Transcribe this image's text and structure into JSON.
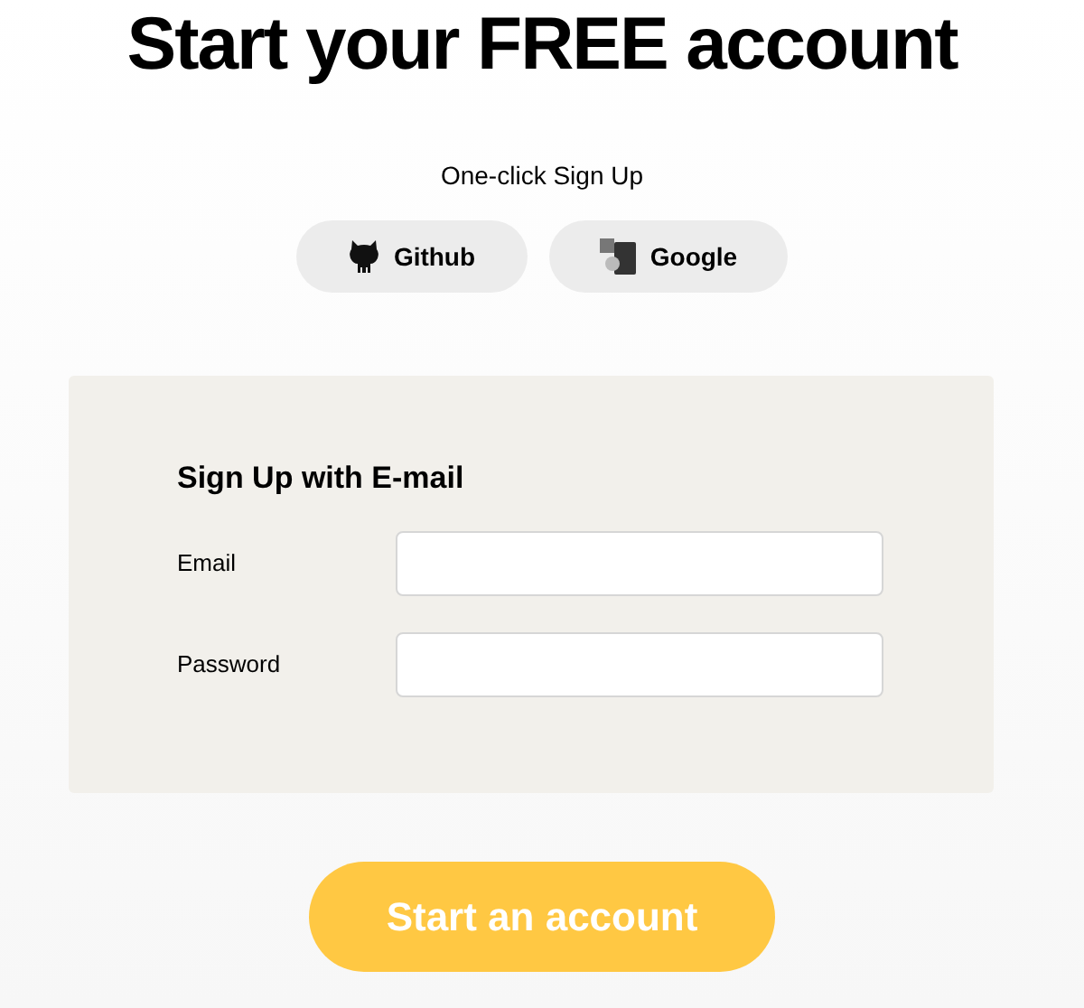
{
  "title": "Start your FREE account",
  "one_click": {
    "label": "One-click Sign Up",
    "buttons": [
      {
        "kind": "github",
        "label": "Github"
      },
      {
        "kind": "google",
        "label": "Google"
      }
    ]
  },
  "email_form": {
    "heading": "Sign Up with E-mail",
    "fields": [
      {
        "label": "Email"
      },
      {
        "label": "Password"
      }
    ]
  },
  "submit": {
    "label": "Start an account"
  }
}
